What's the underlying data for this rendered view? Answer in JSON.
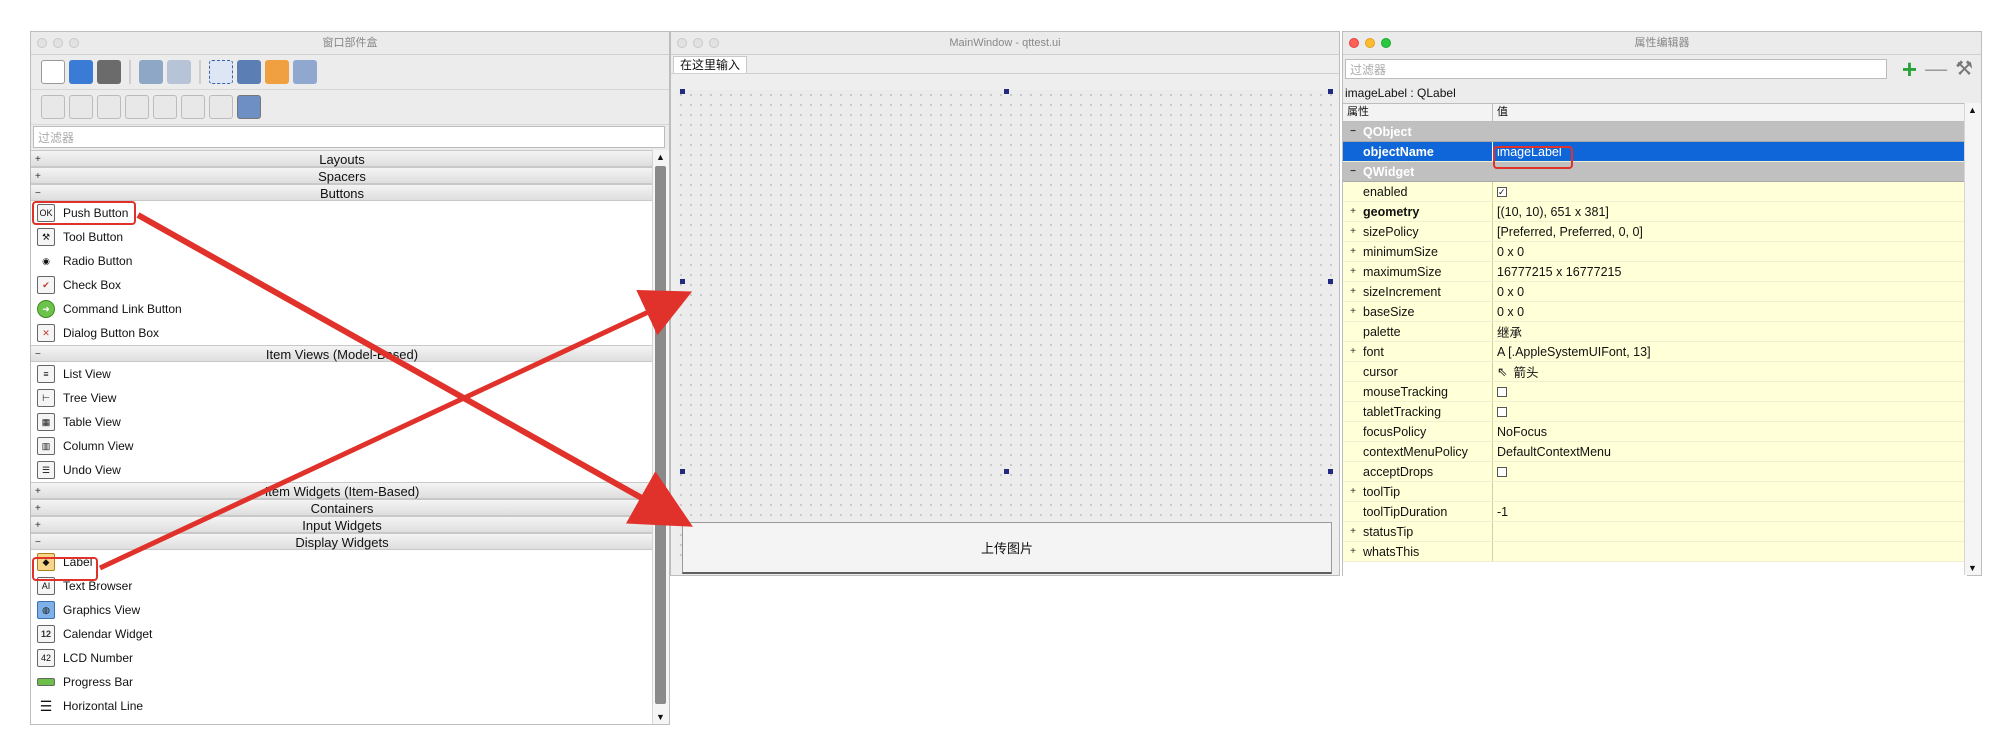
{
  "widget_box": {
    "title": "窗口部件盒",
    "filter_placeholder": "过滤器",
    "categories": {
      "layouts": "Layouts",
      "spacers": "Spacers",
      "buttons": "Buttons",
      "item_views": "Item Views (Model-Based)",
      "item_widgets": "Item Widgets (Item-Based)",
      "containers": "Containers",
      "input_widgets": "Input Widgets",
      "display_widgets": "Display Widgets"
    },
    "buttons_items": [
      "Push Button",
      "Tool Button",
      "Radio Button",
      "Check Box",
      "Command Link Button",
      "Dialog Button Box"
    ],
    "item_views_items": [
      "List View",
      "Tree View",
      "Table View",
      "Column View",
      "Undo View"
    ],
    "display_items": [
      "Label",
      "Text Browser",
      "Graphics View",
      "Calendar Widget",
      "LCD Number",
      "Progress Bar",
      "Horizontal Line"
    ]
  },
  "main_window": {
    "title": "MainWindow - qttest.ui",
    "menu_placeholder": "在这里输入",
    "upload_button": "上传图片"
  },
  "property_editor": {
    "title": "属性编辑器",
    "filter_placeholder": "过滤器",
    "object_line": "imageLabel : QLabel",
    "col_property": "属性",
    "col_value": "值",
    "groups": {
      "qobject": "QObject",
      "qwidget": "QWidget"
    },
    "object_name": {
      "name": "objectName",
      "value": "imageLabel"
    },
    "rows": [
      {
        "name": "enabled",
        "value": "",
        "check": "checked",
        "exp": ""
      },
      {
        "name": "geometry",
        "value": "[(10, 10), 651 x 381]",
        "exp": "+",
        "bold": true
      },
      {
        "name": "sizePolicy",
        "value": "[Preferred, Preferred, 0, 0]",
        "exp": "+"
      },
      {
        "name": "minimumSize",
        "value": "0 x 0",
        "exp": "+"
      },
      {
        "name": "maximumSize",
        "value": "16777215 x 16777215",
        "exp": "+"
      },
      {
        "name": "sizeIncrement",
        "value": "0 x 0",
        "exp": "+"
      },
      {
        "name": "baseSize",
        "value": "0 x 0",
        "exp": "+"
      },
      {
        "name": "palette",
        "value": "继承",
        "exp": ""
      },
      {
        "name": "font",
        "value": "A  [.AppleSystemUIFont, 13]",
        "exp": "+"
      },
      {
        "name": "cursor",
        "value": "箭头",
        "exp": "",
        "arrow": true
      },
      {
        "name": "mouseTracking",
        "value": "",
        "check": "unchecked",
        "exp": ""
      },
      {
        "name": "tabletTracking",
        "value": "",
        "check": "unchecked",
        "exp": ""
      },
      {
        "name": "focusPolicy",
        "value": "NoFocus",
        "exp": ""
      },
      {
        "name": "contextMenuPolicy",
        "value": "DefaultContextMenu",
        "exp": ""
      },
      {
        "name": "acceptDrops",
        "value": "",
        "check": "unchecked",
        "exp": ""
      },
      {
        "name": "toolTip",
        "value": "",
        "exp": "+"
      },
      {
        "name": "toolTipDuration",
        "value": "-1",
        "exp": ""
      },
      {
        "name": "statusTip",
        "value": "",
        "exp": "+"
      },
      {
        "name": "whatsThis",
        "value": "",
        "exp": "+"
      }
    ]
  },
  "colors": {
    "highlight": "#e0322b",
    "selection": "#0f66d8",
    "property_row": "#ffffd8"
  }
}
